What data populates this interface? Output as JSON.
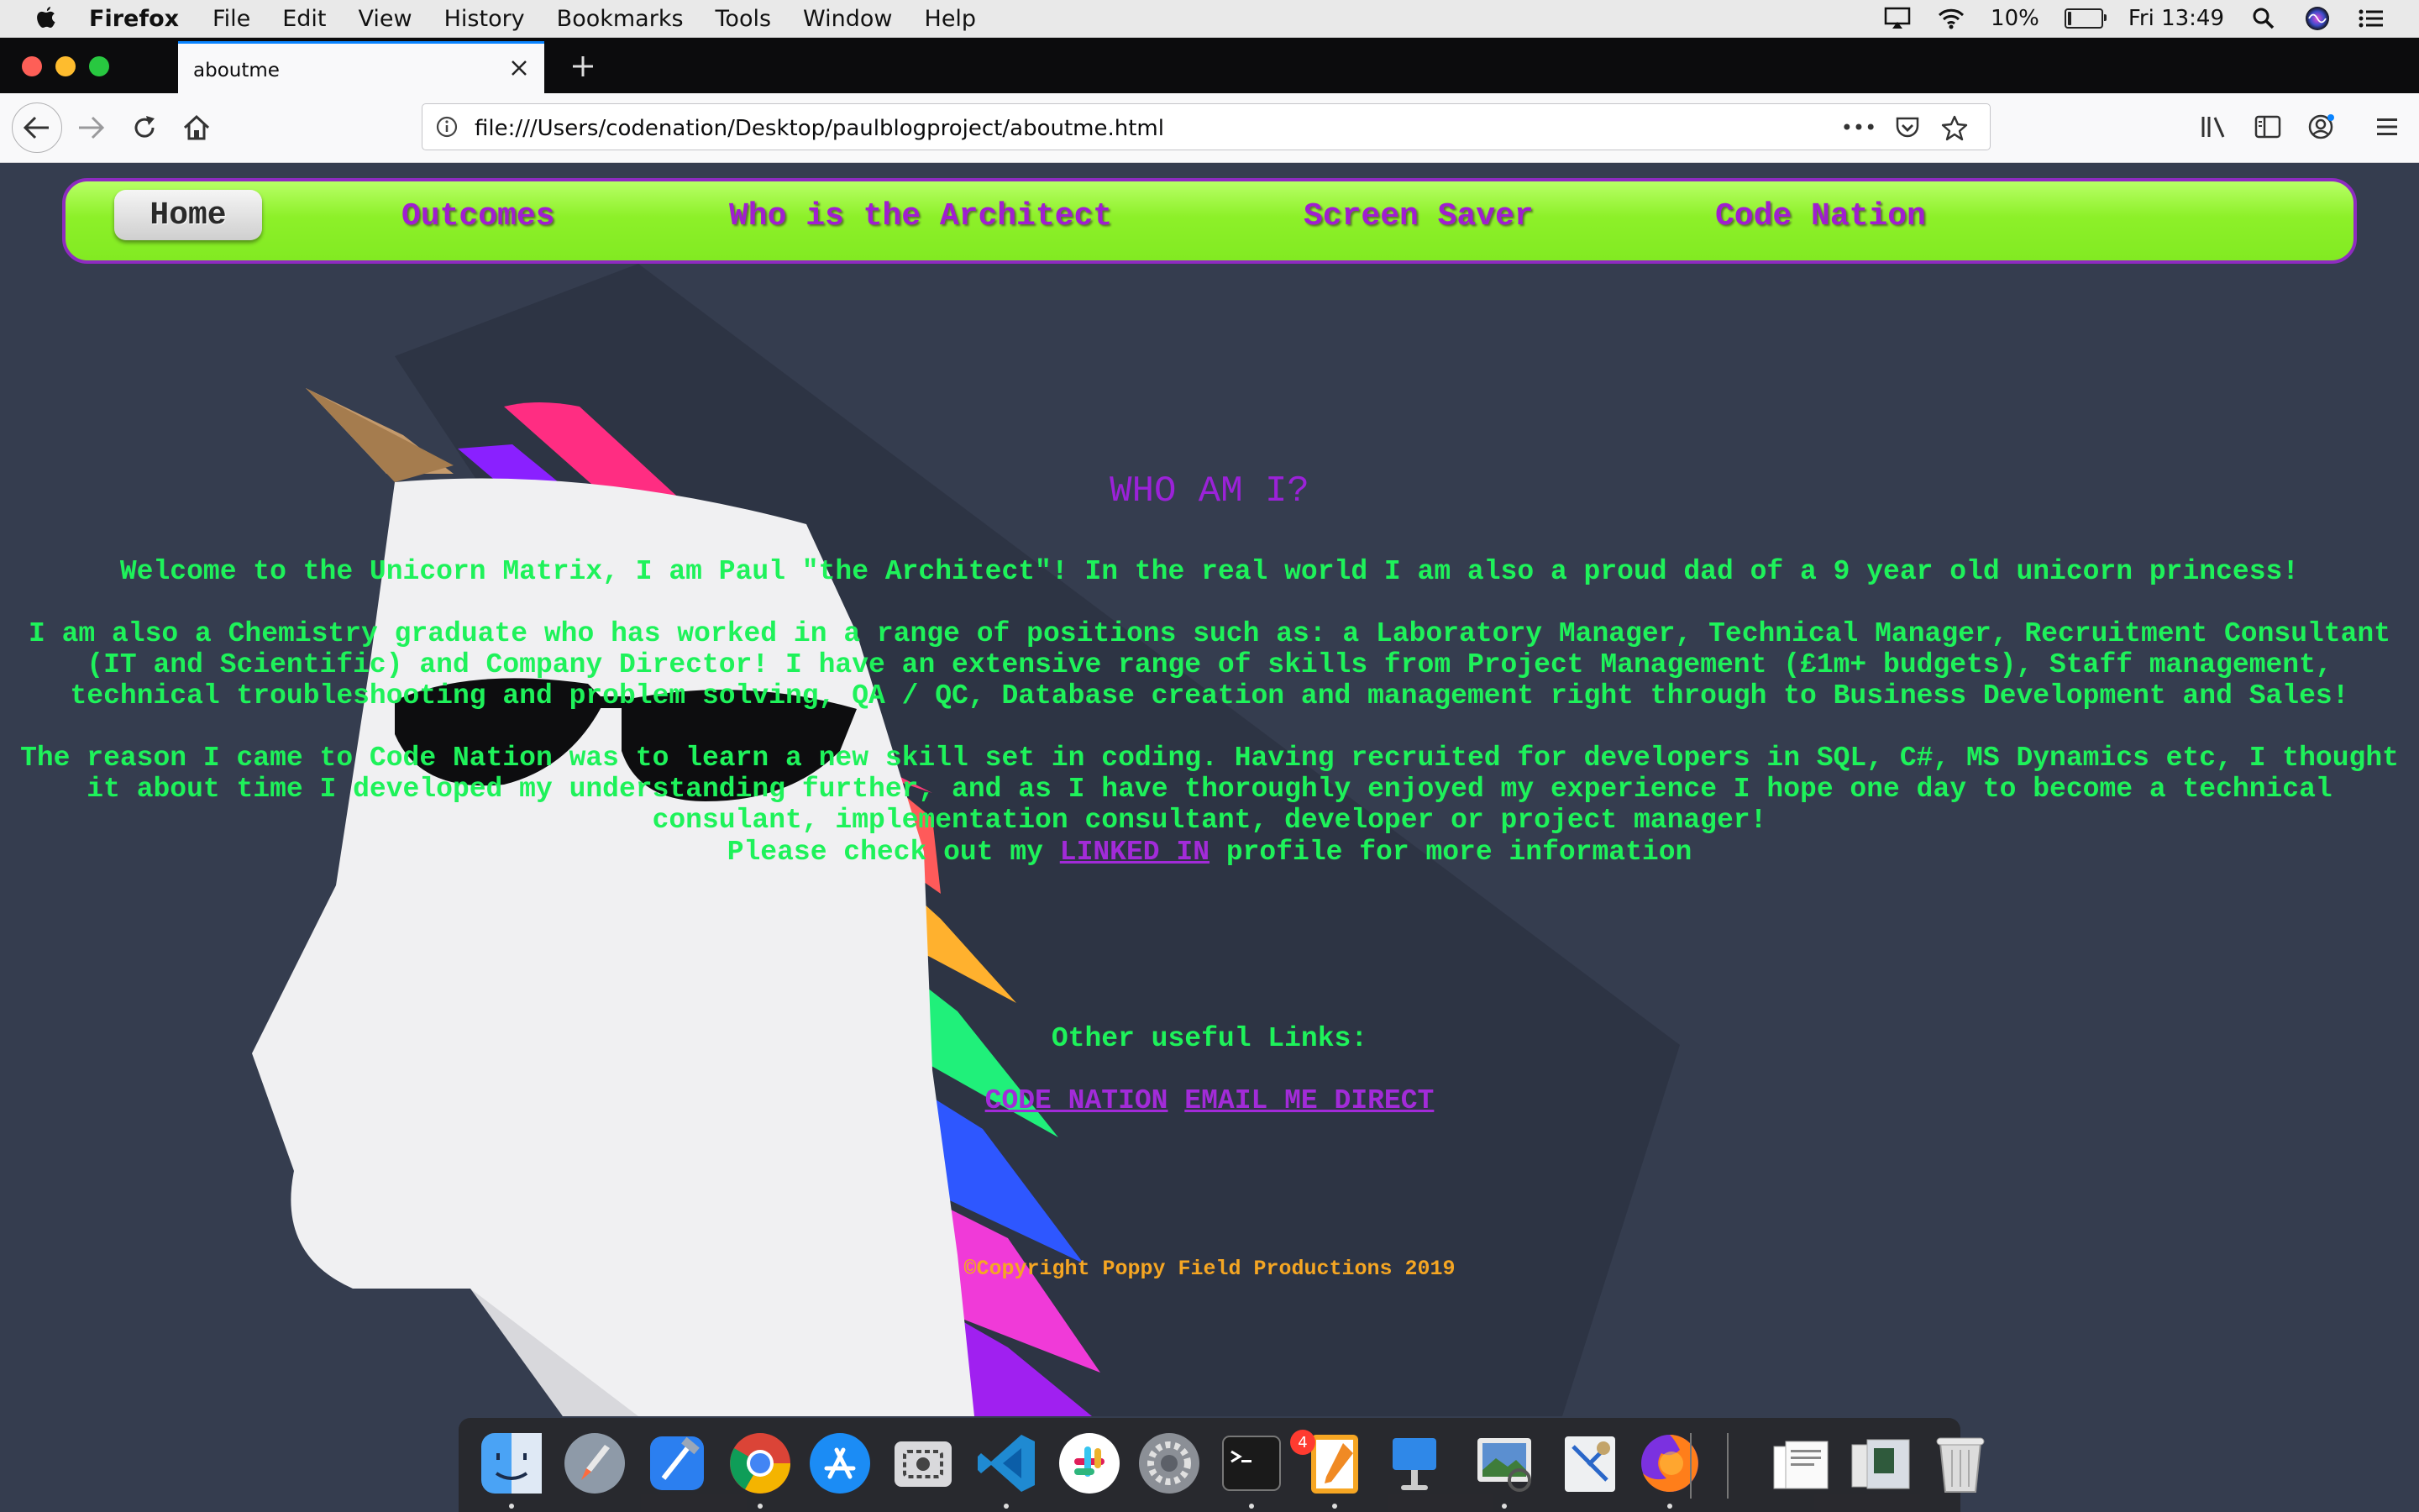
{
  "menubar": {
    "app_name": "Firefox",
    "items": [
      "File",
      "Edit",
      "View",
      "History",
      "Bookmarks",
      "Tools",
      "Window",
      "Help"
    ],
    "battery_percent": "10%",
    "battery_level": 0.1,
    "clock": "Fri 13:49"
  },
  "browser": {
    "tab_title": "aboutme",
    "url": "file:///Users/codenation/Desktop/paulblogproject/aboutme.html",
    "url_more": "•••"
  },
  "site_nav": {
    "home": "Home",
    "outcomes": "Outcomes",
    "architect": "Who is the Architect",
    "screensaver": "Screen Saver",
    "codenation": "Code Nation"
  },
  "content": {
    "heading": "WHO AM I?",
    "para1": "Welcome to the Unicorn Matrix, I am Paul \"the Architect\"! In the real world I am also a proud dad of a 9 year old unicorn princess!",
    "para2": "I am also a Chemistry graduate who has worked in a range of positions such as: a Laboratory Manager, Technical Manager, Recruitment Consultant (IT and Scientific) and Company Director! I have an extensive range of skills from Project Management (£1m+ budgets), Staff management, technical troubleshooting and problem solving, QA / QC, Database creation and management right through to Business Development and Sales!",
    "para3": "The reason I came to Code Nation was to learn a new skill set in coding. Having recruited for developers in SQL, C#, MS Dynamics etc, I thought it about time I developed my understanding further, and as I have thoroughly enjoyed my experience I hope one day to become a technical consulant, implementation consultant, developer or project manager!",
    "linkedin_prefix": "Please check out my",
    "linkedin_link": "LINKED IN",
    "linkedin_suffix": "profile for more information",
    "useful_links": "Other useful Links:",
    "link_codenation": "CODE NATION",
    "link_email": "EMAIL ME DIRECT",
    "copyright": "©Copyright Poppy Field Productions 2019"
  },
  "dock": {
    "app_store_badge": "4",
    "apps": [
      "finder-icon",
      "launchpad-icon",
      "xcode-icon",
      "chrome-icon",
      "app-store-icon",
      "screenshot-icon",
      "vscode-icon",
      "slack-icon",
      "system-preferences-icon",
      "terminal-icon",
      "pages-icon",
      "keynote-icon",
      "preview-icon",
      "mail-icon",
      "firefox-icon",
      "document-stack-icon",
      "image-stack-icon",
      "trash-icon"
    ]
  },
  "colors": {
    "page_background": "#353d4f",
    "nav_green": "#8df029",
    "text_green": "#1ef25a",
    "accent_purple": "#a01ed0",
    "copyright_orange": "#f5a623"
  }
}
